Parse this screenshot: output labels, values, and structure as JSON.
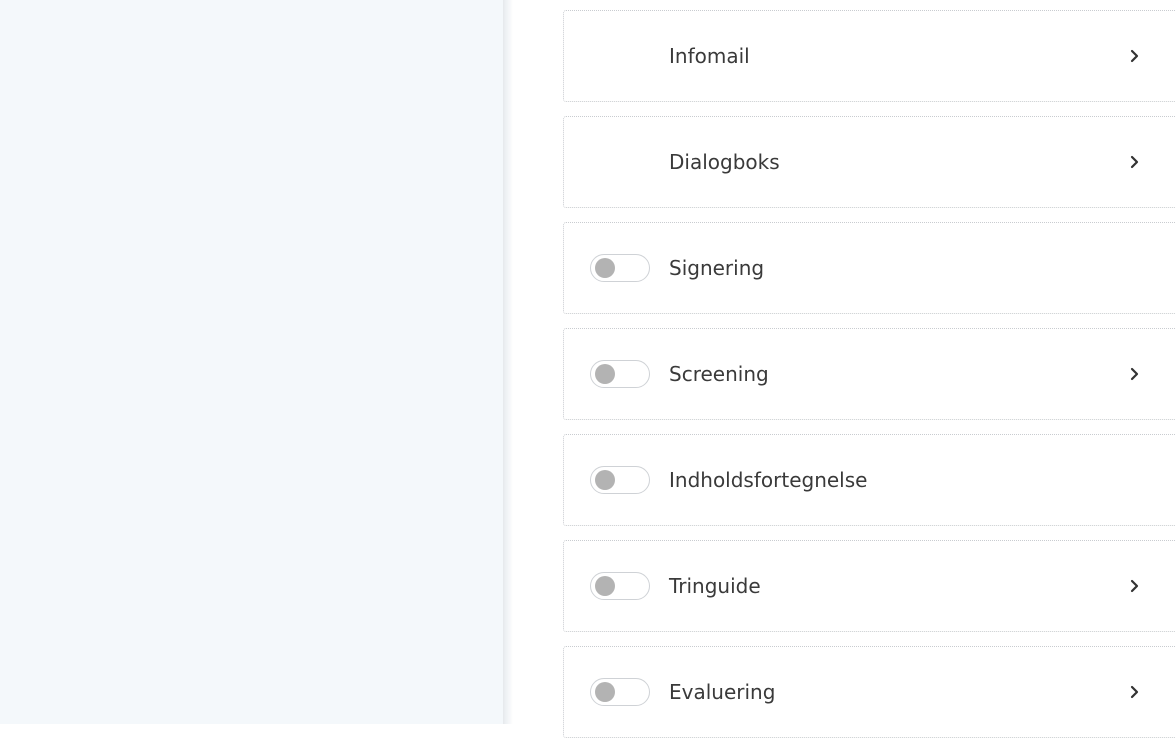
{
  "settings": {
    "items": [
      {
        "label": "Infomail",
        "has_toggle": false,
        "toggle_on": false,
        "has_chevron": true
      },
      {
        "label": "Dialogboks",
        "has_toggle": false,
        "toggle_on": false,
        "has_chevron": true
      },
      {
        "label": "Signering",
        "has_toggle": true,
        "toggle_on": false,
        "has_chevron": false
      },
      {
        "label": "Screening",
        "has_toggle": true,
        "toggle_on": false,
        "has_chevron": true
      },
      {
        "label": "Indholdsfortegnelse",
        "has_toggle": true,
        "toggle_on": false,
        "has_chevron": false
      },
      {
        "label": "Tringuide",
        "has_toggle": true,
        "toggle_on": false,
        "has_chevron": true
      },
      {
        "label": "Evaluering",
        "has_toggle": true,
        "toggle_on": false,
        "has_chevron": true
      }
    ]
  },
  "icons": {
    "chevron": "chevron-right-icon"
  },
  "colors": {
    "left_panel_bg": "#f4f8fb",
    "row_border": "#c9ccd0",
    "label_text": "#3a3a3a",
    "toggle_knob_off": "#b3b3b3"
  }
}
